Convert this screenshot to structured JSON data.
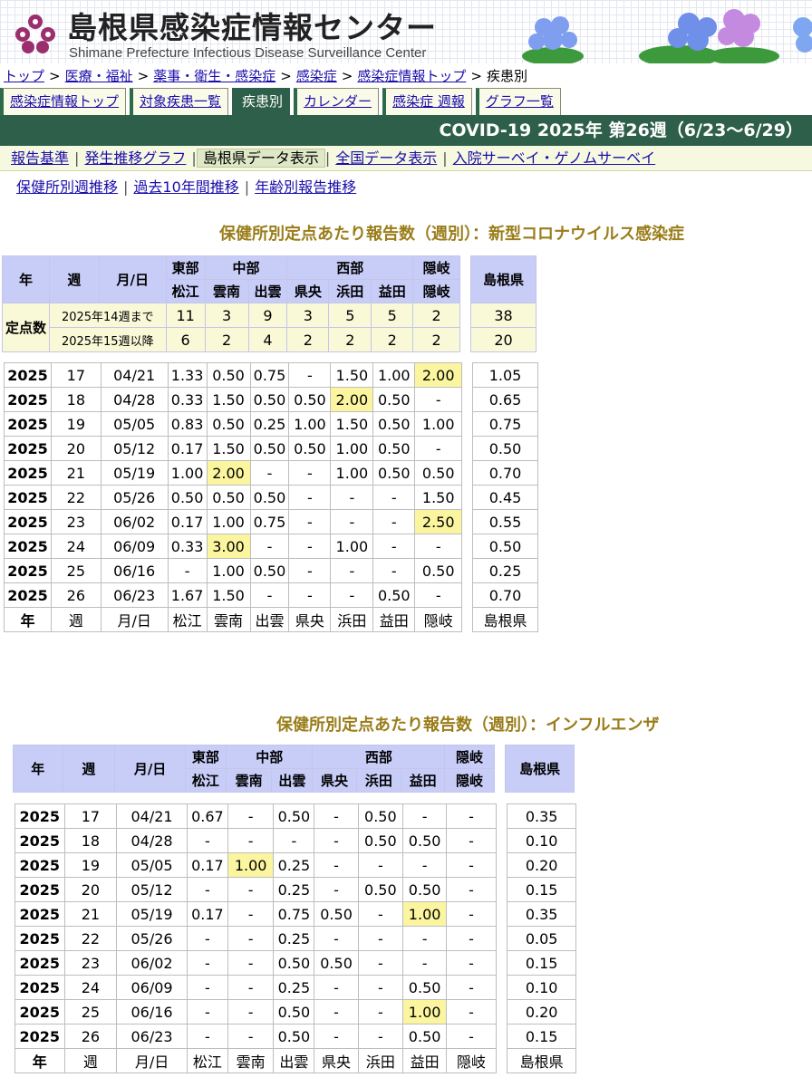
{
  "header": {
    "title": "島根県感染症情報センター",
    "subtitle": "Shimane Prefecture Infectious Disease Surveillance Center"
  },
  "breadcrumb": [
    {
      "label": "トップ",
      "link": true
    },
    {
      "label": "医療・福祉",
      "link": true
    },
    {
      "label": "薬事・衛生・感染症",
      "link": true
    },
    {
      "label": "感染症",
      "link": true
    },
    {
      "label": "感染症情報トップ",
      "link": true
    },
    {
      "label": "疾患別",
      "link": false
    }
  ],
  "tabs": [
    {
      "label": "感染症情報トップ",
      "active": false
    },
    {
      "label": "対象疾患一覧",
      "active": false
    },
    {
      "label": "疾患別",
      "active": true
    },
    {
      "label": "カレンダー",
      "active": false
    },
    {
      "label": "感染症 週報",
      "active": false
    },
    {
      "label": "グラフ一覧",
      "active": false
    }
  ],
  "title_bar": "COVID-19 2025年 第26週（6/23～6/29）",
  "subnav": [
    {
      "label": "報告基準",
      "active": false
    },
    {
      "label": "発生推移グラフ",
      "active": false
    },
    {
      "label": "島根県データ表示",
      "active": true
    },
    {
      "label": "全国データ表示",
      "active": false
    },
    {
      "label": "入院サーベイ・ゲノムサーベイ",
      "active": false
    }
  ],
  "subnav2": [
    "保健所別週推移",
    "過去10年間推移",
    "年齢別報告推移"
  ],
  "colors": {
    "accent_green": "#2e5f4b",
    "header_blue": "#c8cdf8",
    "highlight_yellow": "#fbf5a0",
    "title_gold": "#9a7d1a"
  },
  "headers": {
    "year": "年",
    "week": "週",
    "date": "月/日",
    "regions": {
      "east": "東部",
      "central": "中部",
      "west": "西部",
      "oki": "隠岐"
    },
    "offices": [
      "松江",
      "雲南",
      "出雲",
      "県央",
      "浜田",
      "益田",
      "隠岐"
    ],
    "total": "島根県",
    "sentinel": "定点数"
  },
  "covid": {
    "title": "保健所別定点あたり報告数（週別）：新型コロナウイルス感染症",
    "sentinel_rows": [
      {
        "label": "2025年14週まで",
        "values": [
          "11",
          "3",
          "9",
          "3",
          "5",
          "5",
          "2"
        ],
        "total": "38"
      },
      {
        "label": "2025年15週以降",
        "values": [
          "6",
          "2",
          "4",
          "2",
          "2",
          "2",
          "2"
        ],
        "total": "20"
      }
    ],
    "rows": [
      {
        "year": "2025",
        "week": "17",
        "date": "04/21",
        "values": [
          "1.33",
          "0.50",
          "0.75",
          "-",
          "1.50",
          "1.00",
          "2.00"
        ],
        "total": "1.05",
        "hl": [
          6
        ]
      },
      {
        "year": "2025",
        "week": "18",
        "date": "04/28",
        "values": [
          "0.33",
          "1.50",
          "0.50",
          "0.50",
          "2.00",
          "0.50",
          "-"
        ],
        "total": "0.65",
        "hl": [
          4
        ]
      },
      {
        "year": "2025",
        "week": "19",
        "date": "05/05",
        "values": [
          "0.83",
          "0.50",
          "0.25",
          "1.00",
          "1.50",
          "0.50",
          "1.00"
        ],
        "total": "0.75",
        "hl": []
      },
      {
        "year": "2025",
        "week": "20",
        "date": "05/12",
        "values": [
          "0.17",
          "1.50",
          "0.50",
          "0.50",
          "1.00",
          "0.50",
          "-"
        ],
        "total": "0.50",
        "hl": []
      },
      {
        "year": "2025",
        "week": "21",
        "date": "05/19",
        "values": [
          "1.00",
          "2.00",
          "-",
          "-",
          "1.00",
          "0.50",
          "0.50"
        ],
        "total": "0.70",
        "hl": [
          1
        ]
      },
      {
        "year": "2025",
        "week": "22",
        "date": "05/26",
        "values": [
          "0.50",
          "0.50",
          "0.50",
          "-",
          "-",
          "-",
          "1.50"
        ],
        "total": "0.45",
        "hl": []
      },
      {
        "year": "2025",
        "week": "23",
        "date": "06/02",
        "values": [
          "0.17",
          "1.00",
          "0.75",
          "-",
          "-",
          "-",
          "2.50"
        ],
        "total": "0.55",
        "hl": [
          6
        ]
      },
      {
        "year": "2025",
        "week": "24",
        "date": "06/09",
        "values": [
          "0.33",
          "3.00",
          "-",
          "-",
          "1.00",
          "-",
          "-"
        ],
        "total": "0.50",
        "hl": [
          1
        ]
      },
      {
        "year": "2025",
        "week": "25",
        "date": "06/16",
        "values": [
          "-",
          "1.00",
          "0.50",
          "-",
          "-",
          "-",
          "0.50"
        ],
        "total": "0.25",
        "hl": []
      },
      {
        "year": "2025",
        "week": "26",
        "date": "06/23",
        "values": [
          "1.67",
          "1.50",
          "-",
          "-",
          "-",
          "0.50",
          "-"
        ],
        "total": "0.70",
        "hl": []
      }
    ]
  },
  "flu": {
    "title": "保健所別定点あたり報告数（週別）：インフルエンザ",
    "rows": [
      {
        "year": "2025",
        "week": "17",
        "date": "04/21",
        "values": [
          "0.67",
          "-",
          "0.50",
          "-",
          "0.50",
          "-",
          "-"
        ],
        "total": "0.35",
        "hl": []
      },
      {
        "year": "2025",
        "week": "18",
        "date": "04/28",
        "values": [
          "-",
          "-",
          "-",
          "-",
          "0.50",
          "0.50",
          "-"
        ],
        "total": "0.10",
        "hl": []
      },
      {
        "year": "2025",
        "week": "19",
        "date": "05/05",
        "values": [
          "0.17",
          "1.00",
          "0.25",
          "-",
          "-",
          "-",
          "-"
        ],
        "total": "0.20",
        "hl": [
          1
        ]
      },
      {
        "year": "2025",
        "week": "20",
        "date": "05/12",
        "values": [
          "-",
          "-",
          "0.25",
          "-",
          "0.50",
          "0.50",
          "-"
        ],
        "total": "0.15",
        "hl": []
      },
      {
        "year": "2025",
        "week": "21",
        "date": "05/19",
        "values": [
          "0.17",
          "-",
          "0.75",
          "0.50",
          "-",
          "1.00",
          "-"
        ],
        "total": "0.35",
        "hl": [
          5
        ]
      },
      {
        "year": "2025",
        "week": "22",
        "date": "05/26",
        "values": [
          "-",
          "-",
          "0.25",
          "-",
          "-",
          "-",
          "-"
        ],
        "total": "0.05",
        "hl": []
      },
      {
        "year": "2025",
        "week": "23",
        "date": "06/02",
        "values": [
          "-",
          "-",
          "0.50",
          "0.50",
          "-",
          "-",
          "-"
        ],
        "total": "0.15",
        "hl": []
      },
      {
        "year": "2025",
        "week": "24",
        "date": "06/09",
        "values": [
          "-",
          "-",
          "0.25",
          "-",
          "-",
          "0.50",
          "-"
        ],
        "total": "0.10",
        "hl": []
      },
      {
        "year": "2025",
        "week": "25",
        "date": "06/16",
        "values": [
          "-",
          "-",
          "0.50",
          "-",
          "-",
          "1.00",
          "-"
        ],
        "total": "0.20",
        "hl": [
          5
        ]
      },
      {
        "year": "2025",
        "week": "26",
        "date": "06/23",
        "values": [
          "-",
          "-",
          "0.50",
          "-",
          "-",
          "0.50",
          "-"
        ],
        "total": "0.15",
        "hl": []
      }
    ]
  }
}
